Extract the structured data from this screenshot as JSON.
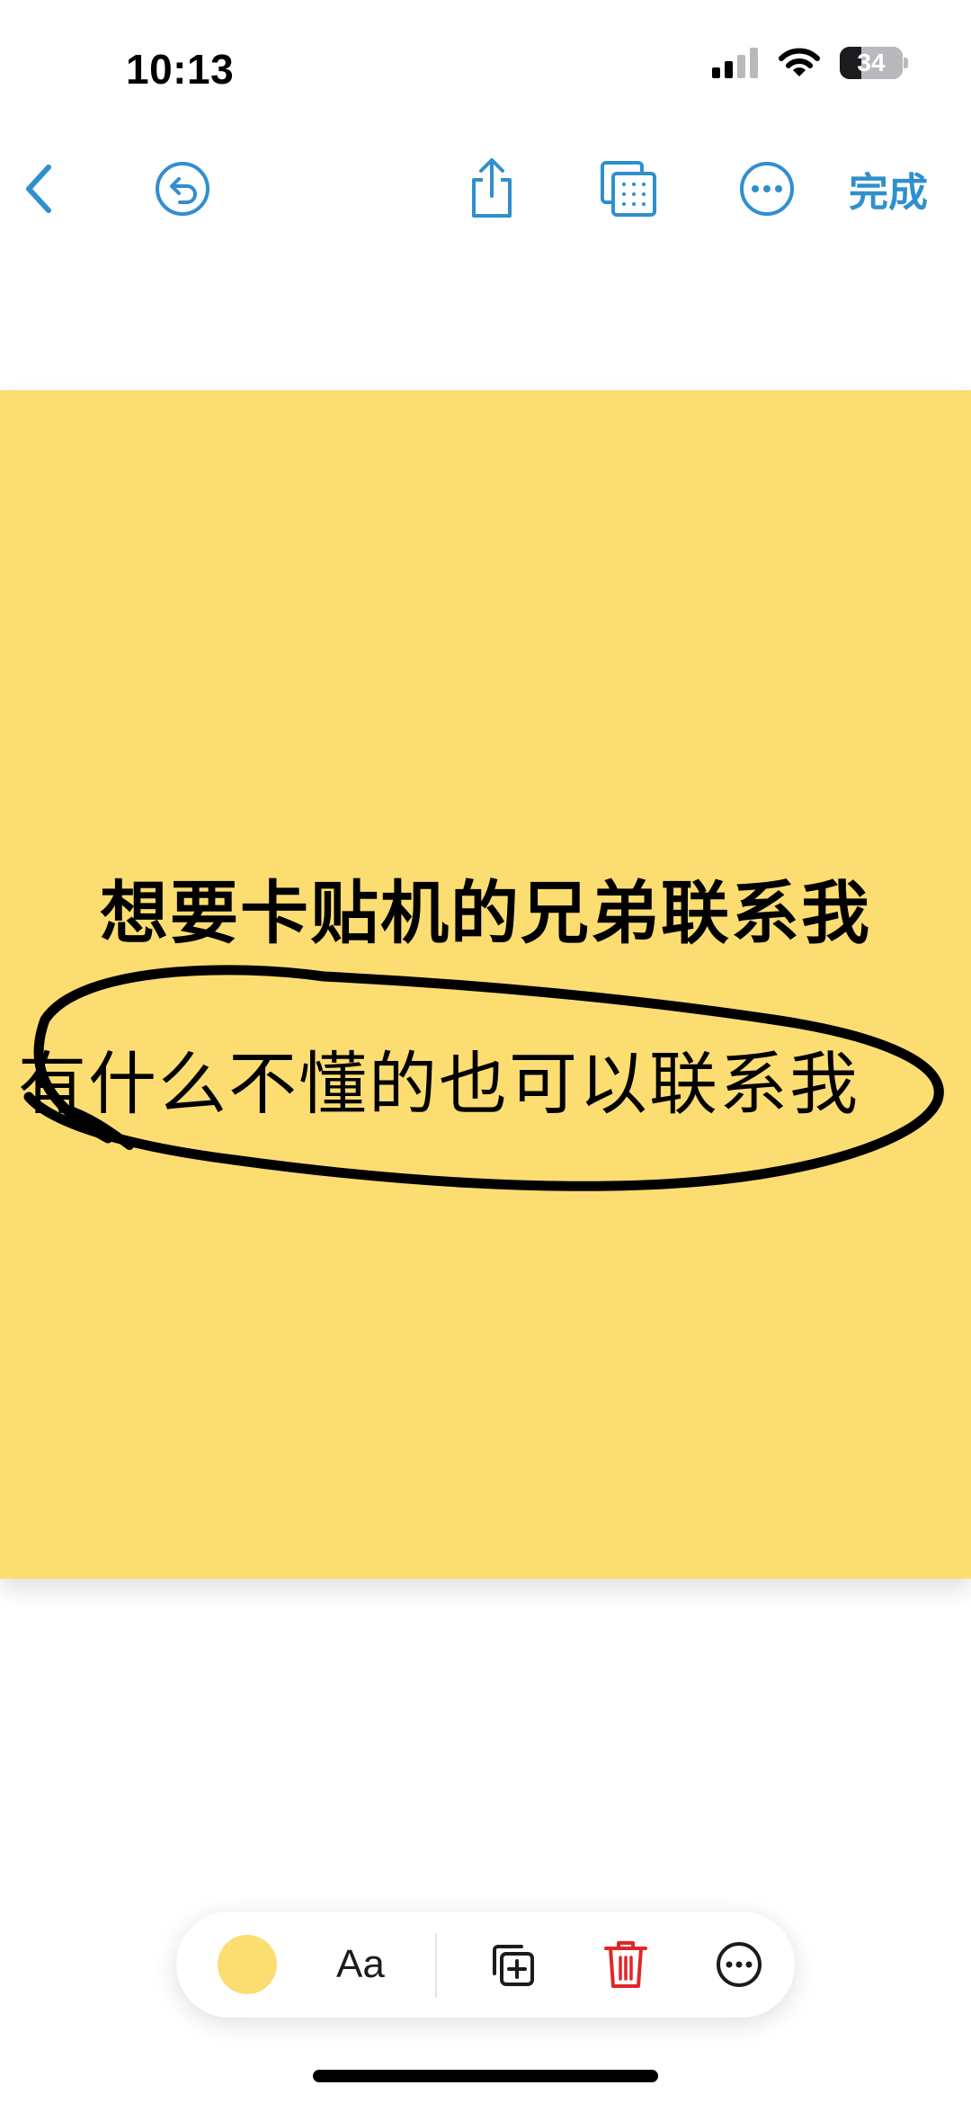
{
  "status_bar": {
    "time": "10:13",
    "battery_level": "34",
    "battery_fraction": 0.34,
    "icons": [
      "cellular-signal-icon",
      "wifi-icon",
      "battery-icon"
    ]
  },
  "toolbar": {
    "icons": [
      "chevron-left-icon",
      "undo-icon",
      "share-icon",
      "multi-page-icon",
      "more-icon"
    ],
    "done_label": "完成",
    "accent_color": "#2f8fcf"
  },
  "note": {
    "background_color": "#fcdd72",
    "line1": "想要卡贴机的兄弟联系我",
    "line2": "有什么不懂的也可以联系我"
  },
  "bottom_bar": {
    "color_swatch": "#fcdd72",
    "text_style_label": "Aa",
    "icons": [
      "color-swatch-icon",
      "duplicate-icon",
      "trash-icon",
      "more-icon"
    ],
    "trash_color": "#e0262a"
  }
}
